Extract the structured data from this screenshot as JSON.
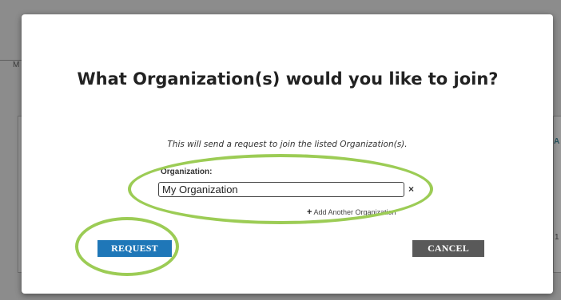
{
  "background": {
    "left_fragment": "M",
    "right_fragment_1": "A",
    "right_fragment_2": "1"
  },
  "dialog": {
    "title": "What Organization(s) would you like to join?",
    "subtitle": "This will send a request to join the listed Organization(s).",
    "organization_label": "Organization:",
    "organization_value": "My Organization",
    "remove_glyph": "×",
    "add_another_label": "Add Another Organization",
    "request_button": "REQUEST",
    "cancel_button": "CANCEL"
  },
  "colors": {
    "request_button_bg": "#1f77b8",
    "cancel_button_bg": "#595959",
    "highlight_ellipse": "#9ccc55"
  }
}
